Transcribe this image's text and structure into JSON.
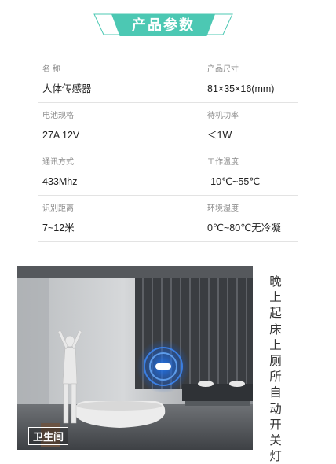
{
  "header": {
    "title": "产品参数"
  },
  "specs": [
    {
      "left": {
        "label": "名  称",
        "value": "人体传感器"
      },
      "right": {
        "label": "产品尺寸",
        "value": "81×35×16(mm)"
      }
    },
    {
      "left": {
        "label": "电池规格",
        "value": "27A 12V"
      },
      "right": {
        "label": "待机功率",
        "value": "＜1W"
      }
    },
    {
      "left": {
        "label": "通讯方式",
        "value": "433Mhz"
      },
      "right": {
        "label": "工作温度",
        "value": "-10℃~55℃"
      }
    },
    {
      "left": {
        "label": "识别距离",
        "value": "7~12米"
      },
      "right": {
        "label": "环境湿度",
        "value": "0℃~80℃无冷凝"
      }
    }
  ],
  "scene": {
    "room_label": "卫生间",
    "caption": "晚上起床上厕所自动开关灯"
  },
  "colors": {
    "accent": "#4cc8b3",
    "divider": "#e3e3e3"
  }
}
